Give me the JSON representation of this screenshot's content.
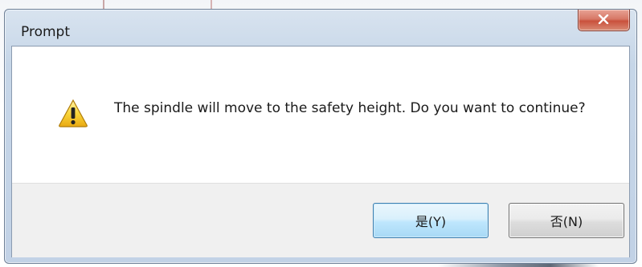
{
  "dialog": {
    "title": "Prompt",
    "message": "The spindle will move to the safety height. Do you want to continue?",
    "icon": "warning-icon",
    "buttons": {
      "yes_label": "是(Y)",
      "no_label": "否(N)"
    }
  },
  "colors": {
    "default_button_border": "#3c7fb1",
    "close_button": "#c9513c",
    "warning_yellow": "#f5c518"
  }
}
